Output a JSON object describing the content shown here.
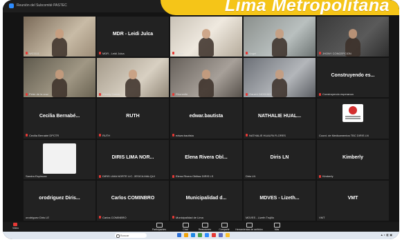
{
  "window": {
    "title": "Reunión del Subcomité PASTEC"
  },
  "banner": {
    "text": "Lima Metropolitana",
    "color": "#f5c518"
  },
  "tiles": [
    {
      "kind": "video",
      "label": "WC1111",
      "mic_muted": true
    },
    {
      "kind": "name",
      "name": "MDR - Leidi Julca",
      "label": "MDR - Leidi Julca",
      "mic_muted": true
    },
    {
      "kind": "video",
      "label": "Dailyn",
      "mic_muted": true
    },
    {
      "kind": "video",
      "label": "Angel",
      "mic_muted": true
    },
    {
      "kind": "video",
      "label": "JHONY CONCEPCION",
      "mic_muted": true
    },
    {
      "kind": "video",
      "label": "Peter de la cruz",
      "mic_muted": true
    },
    {
      "kind": "video",
      "label": "Wendy Cabos",
      "mic_muted": true
    },
    {
      "kind": "video",
      "label": "Rhonerife",
      "mic_muted": true
    },
    {
      "kind": "video",
      "label": "Gauchi 24091969",
      "mic_muted": true
    },
    {
      "kind": "name",
      "name": "Construyendo es...",
      "label": "Construyendo esperanza",
      "mic_muted": true
    },
    {
      "kind": "name",
      "name": "Cecilia Bernabé...",
      "label": "Cecilia Bernabé DPCTR",
      "mic_muted": true
    },
    {
      "kind": "name",
      "name": "RUTH",
      "label": "RUTH",
      "mic_muted": true
    },
    {
      "kind": "name",
      "name": "edwar.bautista",
      "label": "edwar.bautista",
      "mic_muted": true
    },
    {
      "kind": "name",
      "name": "NATHALIE HUAL...",
      "label": "NATHALIE HUALPA FLORES",
      "mic_muted": true
    },
    {
      "kind": "logo",
      "label": "Coord. de Medicamentos TBC DIRIS LN",
      "mic_muted": false
    },
    {
      "kind": "blank",
      "label": "Sandra Espinoza",
      "mic_muted": false
    },
    {
      "kind": "name",
      "name": "DIRIS LIMA NOR...",
      "label": "DIRIS LIMA NORTE LIC. JESICA MALQUI",
      "mic_muted": true
    },
    {
      "kind": "name",
      "name": "Elena Rivera Obl...",
      "label": "Elena Rivera Oblitas DIRIS LS",
      "mic_muted": true
    },
    {
      "kind": "name",
      "name": "Diris LN",
      "label": "Diris LN",
      "mic_muted": false
    },
    {
      "kind": "name",
      "name": "Kimberly",
      "label": "Kimberly",
      "mic_muted": true
    },
    {
      "kind": "name",
      "name": "orodriguez Diris...",
      "label": "orodriguez Diris LE",
      "mic_muted": false
    },
    {
      "kind": "name",
      "name": "Carlos COMINBRO",
      "label": "Carlos COMINBRO",
      "mic_muted": true
    },
    {
      "kind": "name",
      "name": "Municipalidad d...",
      "label": "Municipalidad de Lima",
      "mic_muted": true
    },
    {
      "kind": "name",
      "name": "MDVES - Lizeth...",
      "label": "MDVES - Lizeth Trujillo",
      "mic_muted": false
    },
    {
      "kind": "name",
      "name": "VMT",
      "label": "VMT",
      "mic_muted": false
    }
  ],
  "toolbar": {
    "video": "Video",
    "participants": "Participantes",
    "chat": "Chat",
    "reactions": "Reacciones",
    "share": "Compartir",
    "whiteboards": "Herramientas de anfitrión",
    "more": "Más"
  },
  "taskbar": {
    "search_placeholder": "Buscar"
  }
}
